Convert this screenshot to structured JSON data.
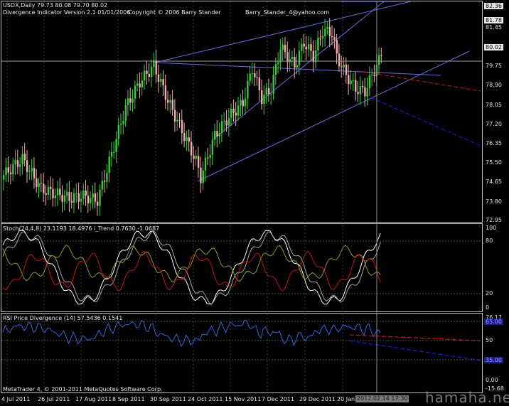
{
  "chart_header": {
    "symbol_line": "USDX,Daily  79.73 80.08 79.70 80.02",
    "indicator_name": "Divergence Indicator Version 2.1  01/01/2006",
    "copyright": "Copyright © 2006 Barry Stander",
    "email": "Barry_Stander_4@yahoo.com"
  },
  "stoch_label": "Stoch(24,4,8) 23.1193 18.4976  i_Trend 0.7630 -1.0687",
  "rsi_label": "RSI Price Divergence (14) 57.5436 0.1541",
  "footer": "MetaTrader 4, © 2001-2011 MetaQuotes Software Corp.",
  "watermark": "hamaha.net",
  "colors": {
    "bull_candle": "#3cc83c",
    "bear_candle": "#f0b0b0",
    "trendline": "#6a6ae0",
    "divergence_red": "#c81818",
    "divergence_blue": "#1c1ce0",
    "stoch_main": "#ffffff",
    "trend_olive": "#8a9a2a",
    "trend_red": "#c01818",
    "rsi": "#3c64d8"
  },
  "price_scale": [
    "82.36",
    "81.78",
    "81.45",
    "80.02",
    "79.75",
    "78.90",
    "78.05",
    "77.20",
    "76.35",
    "75.50",
    "74.65",
    "73.80",
    "72.95"
  ],
  "price_tags": {
    "top": "82.36",
    "resistance": "81.78",
    "current": "80.02"
  },
  "stoch_scale": [
    "100",
    "80",
    "20",
    "0"
  ],
  "rsi_scale": [
    "76.17",
    "50",
    "0.00",
    "-15.68"
  ],
  "rsi_tags": {
    "upper": "65.00",
    "lower": "35.00"
  },
  "x_labels": [
    "4 Jul 2011",
    "26 Jul 2011",
    "17 Aug 2011",
    "8 Sep 2011",
    "30 Sep 2011",
    "24 Oct 2011",
    "15 Nov 2011",
    "7 Dec 2011",
    "29 Dec 2011",
    "20 Jan",
    "2012.02.14 17:30"
  ],
  "chart_data": [
    {
      "type": "line",
      "title": "USDX,Daily  79.73 80.08 79.70 80.02",
      "xlabel": "",
      "ylabel": "",
      "ylim": [
        72.95,
        82.36
      ],
      "x": [
        "4 Jul 2011",
        "26 Jul 2011",
        "17 Aug 2011",
        "8 Sep 2011",
        "30 Sep 2011",
        "24 Oct 2011",
        "15 Nov 2011",
        "7 Dec 2011",
        "29 Dec 2011",
        "20 Jan",
        "2012.02.14"
      ],
      "series": [
        {
          "values": [
            74.9,
            74.2,
            74.0,
            75.6,
            79.6,
            74.8,
            78.6,
            78.5,
            81.1,
            78.4,
            80.02
          ]
        }
      ]
    },
    {
      "type": "line",
      "title": "Stoch(24,4,8) 23.1193 18.4976  i_Trend 0.7630 -1.0687",
      "ylim": [
        0,
        100
      ],
      "x": [
        "4 Jul 2011",
        "26 Jul 2011",
        "17 Aug 2011",
        "8 Sep 2011",
        "30 Sep 2011",
        "24 Oct 2011",
        "15 Nov 2011",
        "7 Dec 2011",
        "29 Dec 2011",
        "20 Jan",
        "2012.02.14"
      ],
      "series": [
        {
          "values": [
            45,
            35,
            20,
            80,
            95,
            20,
            75,
            65,
            90,
            8,
            23.1193
          ]
        },
        {
          "values": [
            50,
            40,
            25,
            75,
            90,
            25,
            70,
            60,
            85,
            10,
            18.4976
          ]
        }
      ]
    },
    {
      "type": "line",
      "title": "RSI Price Divergence (14) 57.5436 0.1541",
      "ylim": [
        -15.68,
        76.17
      ],
      "x": [
        "4 Jul 2011",
        "26 Jul 2011",
        "17 Aug 2011",
        "8 Sep 2011",
        "30 Sep 2011",
        "24 Oct 2011",
        "15 Nov 2011",
        "7 Dec 2011",
        "29 Dec 2011",
        "20 Jan",
        "2012.02.14"
      ],
      "series": [
        {
          "values": [
            55,
            52,
            48,
            62,
            68,
            45,
            60,
            56,
            63,
            42,
            57.5436
          ]
        }
      ]
    }
  ]
}
